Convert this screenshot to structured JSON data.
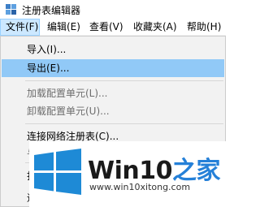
{
  "window": {
    "title": "注册表编辑器"
  },
  "menubar": {
    "file": "文件(F)",
    "edit": "编辑(E)",
    "view": "查看(V)",
    "favorites": "收藏夹(A)",
    "help": "帮助(H)"
  },
  "file_menu": {
    "items": [
      {
        "label": "导入(I)...",
        "state": "enabled"
      },
      {
        "label": "导出(E)...",
        "state": "hover"
      },
      {
        "label": "加载配置单元(L)...",
        "state": "disabled"
      },
      {
        "label": "卸载配置单元(U)...",
        "state": "disabled"
      },
      {
        "label": "连接网络注册表(C)...",
        "state": "enabled"
      },
      {
        "label": "与",
        "state": "disabled"
      },
      {
        "label": "打",
        "state": "enabled"
      },
      {
        "label": "退",
        "state": "enabled"
      }
    ]
  },
  "watermark": {
    "brand_main": "Win10",
    "brand_accent": "之家",
    "url": "www.win10xitong.com"
  },
  "colors": {
    "hover": "#91c9f7",
    "menu_active": "#cce8ff",
    "logo_blue": "#1e8ad6"
  }
}
